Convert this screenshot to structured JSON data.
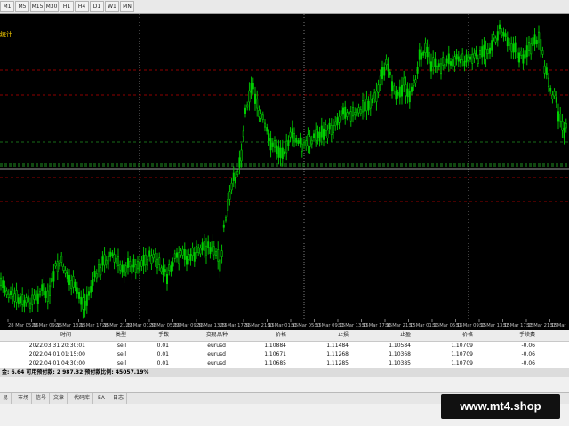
{
  "timeframes": [
    "M1",
    "M5",
    "M15",
    "M30",
    "H1",
    "H4",
    "D1",
    "W1",
    "MN"
  ],
  "chart": {
    "symbol_label": "统计",
    "colors": {
      "background": "#000000",
      "candles": "#00d000",
      "grid": "#5a5a5a",
      "level_red": "#c00000",
      "level_green": "#1f8f1f",
      "separator": "#d0d0d0"
    },
    "time_labels": [
      "28 Mar 05:15",
      "28 Mar 09:15",
      "28 Mar 13:15",
      "28 Mar 17:15",
      "28 Mar 21:15",
      "29 Mar 01:15",
      "29 Mar 05:15",
      "29 Mar 09:15",
      "29 Mar 13:15",
      "29 Mar 17:15",
      "29 Mar 21:15",
      "30 Mar 01:15",
      "30 Mar 05:15",
      "30 Mar 09:15",
      "30 Mar 13:15",
      "30 Mar 17:15",
      "30 Mar 21:15",
      "31 Mar 01:15",
      "31 Mar 05:15",
      "31 Mar 09:15",
      "31 Mar 13:15",
      "31 Mar 17:15",
      "31 Mar 21:15",
      "31 Mar"
    ]
  },
  "terminal": {
    "columns": [
      "时间",
      "类型",
      "手数",
      "交易品种",
      "价格",
      "止损",
      "止盈",
      "价格",
      "手续费"
    ],
    "rows": [
      {
        "time": "2022.03.31 20:30:01",
        "type": "sell",
        "lots": "0.01",
        "symbol": "eurusd",
        "price": "1.10884",
        "sl": "1.11484",
        "tp": "1.10584",
        "cur": "1.10709",
        "fee": "-0.06"
      },
      {
        "time": "2022.04.01 01:15:00",
        "type": "sell",
        "lots": "0.01",
        "symbol": "eurusd",
        "price": "1.10671",
        "sl": "1.11268",
        "tp": "1.10368",
        "cur": "1.10709",
        "fee": "-0.06"
      },
      {
        "time": "2022.04.01 04:30:00",
        "type": "sell",
        "lots": "0.01",
        "symbol": "eurusd",
        "price": "1.10685",
        "sl": "1.11285",
        "tp": "1.10385",
        "cur": "1.10709",
        "fee": "-0.06"
      }
    ],
    "summary": "金: 6.64  可用预付款: 2 987.32  预付款比例: 45057.19%",
    "tabs": [
      "易",
      "市场",
      "信号",
      "文章",
      "代码库",
      "EA",
      "日志"
    ]
  },
  "watermark": "www.mt4.shop"
}
